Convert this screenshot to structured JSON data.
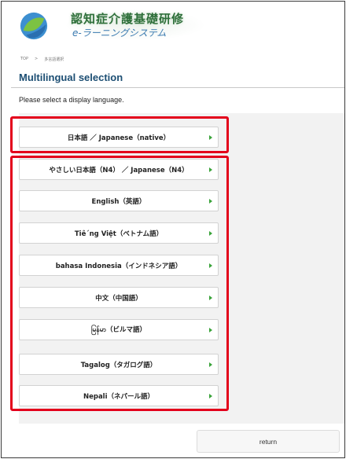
{
  "header": {
    "title": "認知症介護基礎研修",
    "subtitle": "e-ラーニングシステム"
  },
  "breadcrumb": {
    "home": "TOP",
    "separator": ">",
    "current": "多言語選択"
  },
  "page": {
    "title": "Multilingual selection",
    "instruction": "Please select a display language."
  },
  "languages": [
    {
      "label": "日本語 ／ Japanese（native）"
    },
    {
      "label": "やさしい日本語（N4） ／ Japanese（N4）"
    },
    {
      "label": "English（英語）"
    },
    {
      "label": "Tiê´ng Việt（ベトナム語）"
    },
    {
      "label": "bahasa Indonesia（インドネシア語）"
    },
    {
      "label": "中文（中国語）"
    },
    {
      "label": "မြန်မာ（ビルマ語）"
    },
    {
      "label": "Tagalog（タガログ語）"
    },
    {
      "label": "Nepali（ネパール語）"
    }
  ],
  "footer": {
    "return_label": "return"
  },
  "colors": {
    "accent_title": "#1c4e73",
    "highlight_border": "#e3001b",
    "arrow": "#3aa33a"
  }
}
